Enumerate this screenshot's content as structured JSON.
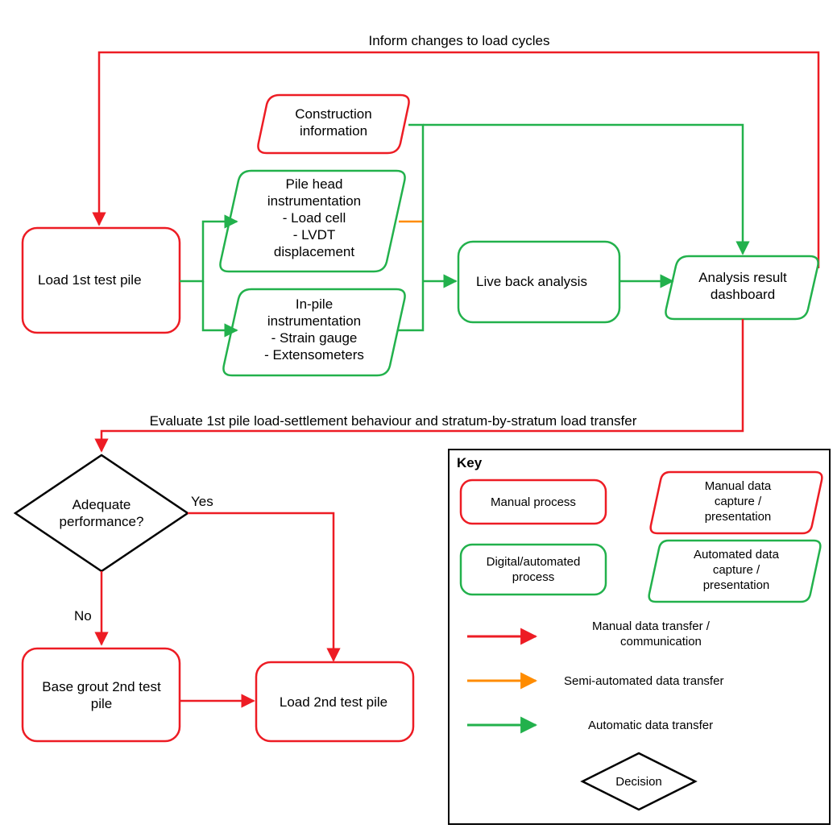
{
  "nodes": {
    "load1": "Load 1st test pile",
    "construction_l1": "Construction",
    "construction_l2": "information",
    "pilehead_l1": "Pile head",
    "pilehead_l2": "instrumentation",
    "pilehead_l3": "- Load cell",
    "pilehead_l4": "- LVDT",
    "pilehead_l5": "displacement",
    "inpile_l1": "In-pile",
    "inpile_l2": "instrumentation",
    "inpile_l3": "- Strain gauge",
    "inpile_l4": "- Extensometers",
    "liveback": "Live back analysis",
    "dashboard_l1": "Analysis result",
    "dashboard_l2": "dashboard",
    "decision_l1": "Adequate",
    "decision_l2": "performance?",
    "basegrout_l1": "Base grout 2nd test",
    "basegrout_l2": "pile",
    "load2": "Load 2nd test pile"
  },
  "edges": {
    "informchanges": "Inform changes to load cycles",
    "evaluate": "Evaluate 1st pile load-settlement behaviour and stratum-by-stratum load transfer",
    "yes": "Yes",
    "no": "No"
  },
  "key": {
    "title": "Key",
    "manual_process": "Manual process",
    "manual_data_l1": "Manual data",
    "manual_data_l2": "capture /",
    "manual_data_l3": "presentation",
    "digital_l1": "Digital/automated",
    "digital_l2": "process",
    "auto_data_l1": "Automated data",
    "auto_data_l2": "capture /",
    "auto_data_l3": "presentation",
    "manual_transfer_l1": "Manual data transfer /",
    "manual_transfer_l2": "communication",
    "semi_auto": "Semi-automated data transfer",
    "auto_transfer": "Automatic data transfer",
    "decision": "Decision"
  },
  "colors": {
    "red": "#ED1C24",
    "green": "#22B14C",
    "orange": "#FF8C00",
    "black": "#000000"
  }
}
